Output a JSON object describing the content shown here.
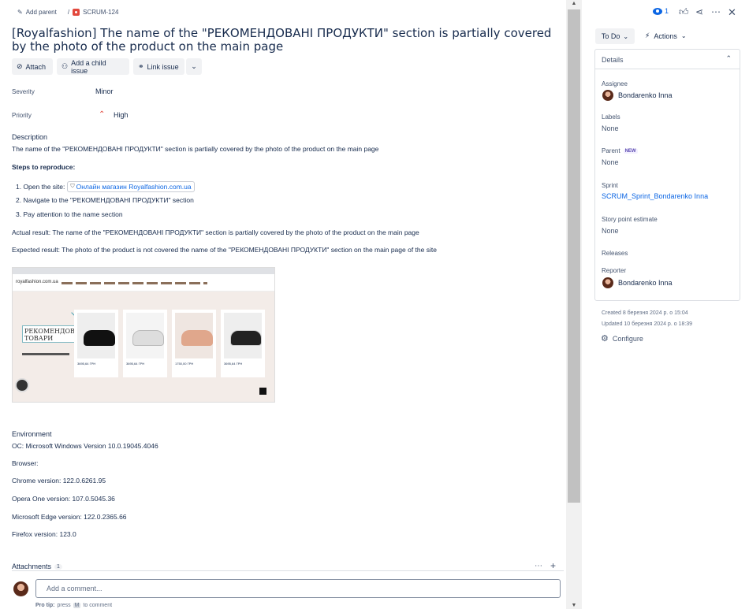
{
  "breadcrumb": {
    "add_parent": "Add parent",
    "separator": "/",
    "issue_key": "SCRUM-124"
  },
  "issue": {
    "title": "[Royalfashion] The name of the \"РЕКОМЕНДОВАНІ ПРОДУКТИ\" section is partially covered by the photo of the product on the main page"
  },
  "toolbar": {
    "attach": "Attach",
    "add_child": "Add a child issue",
    "link_issue": "Link issue"
  },
  "fields": {
    "severity_label": "Severity",
    "severity_value": "Minor",
    "priority_label": "Priority",
    "priority_value": "High"
  },
  "description": {
    "heading": "Description",
    "summary": "The name of the \"РЕКОМЕНДОВАНІ ПРОДУКТИ\" section is partially covered by the photo of the product on the main page",
    "steps_heading": "Steps to reproduce:",
    "step1_prefix": "1. Open the site:",
    "step1_link": "Онлайн магазин Royalfashion.com.ua",
    "step2": "2. Navigate to the  \"РЕКОМЕНДОВАНІ ПРОДУКТИ\" section",
    "step3": "3. Pay attention to the name section",
    "actual": "Actual  result: The name of the \"РЕКОМЕНДОВАНІ ПРОДУКТИ\" section is partially covered by the photo of the product on the main page",
    "expected": "Expected result: The photo of the product is not covered the name of the \"РЕКОМЕНДОВАНІ ПРОДУКТИ\" section on the main page of the site"
  },
  "screenshot": {
    "site_logo": "royalfashion.com.ua",
    "banner_line1": "РЕКОМЕНДОВАН",
    "banner_line2": "ТОВАРИ",
    "prices": [
      "3695,64 ГРН",
      "3695,64 ГРН",
      "1750,00 ГРН",
      "3695,64 ГРН"
    ]
  },
  "environment": {
    "heading": "Environment",
    "os": "ОС: Microsoft Windows Version 10.0.19045.4046",
    "browser": "Browser:",
    "chrome": "Chrome version: 122.0.6261.95",
    "opera": "Opera One version: 107.0.5045.36",
    "edge": "Microsoft Edge version: 122.0.2365.66",
    "firefox": "Firefox version: 123.0"
  },
  "attachments": {
    "label": "Attachments",
    "count": "1"
  },
  "comment": {
    "placeholder": "Add a comment...",
    "tip_prefix": "Pro tip:",
    "tip_mid": "press",
    "tip_key": "M",
    "tip_suffix": "to comment"
  },
  "header_actions": {
    "watch_count": "1"
  },
  "status": {
    "current": "To Do",
    "actions": "Actions"
  },
  "details": {
    "heading": "Details",
    "assignee_label": "Assignee",
    "assignee": "Bondarenko Inna",
    "labels_label": "Labels",
    "labels": "None",
    "parent_label": "Parent",
    "parent_badge": "NEW",
    "parent": "None",
    "sprint_label": "Sprint",
    "sprint": "SCRUM_Sprint_Bondarenko Inna",
    "story_label": "Story point estimate",
    "story": "None",
    "releases_label": "Releases",
    "reporter_label": "Reporter",
    "reporter": "Bondarenko Inna"
  },
  "meta": {
    "created": "Created 8 березня 2024 р. о 15:04",
    "updated": "Updated 10 березня 2024 р. о 18:39",
    "configure": "Configure"
  },
  "colors": {
    "link": "#0c66e4",
    "priority_high": "#e2483d",
    "badge_new": "#5e4db2",
    "issue_icon": "#e2483d"
  }
}
